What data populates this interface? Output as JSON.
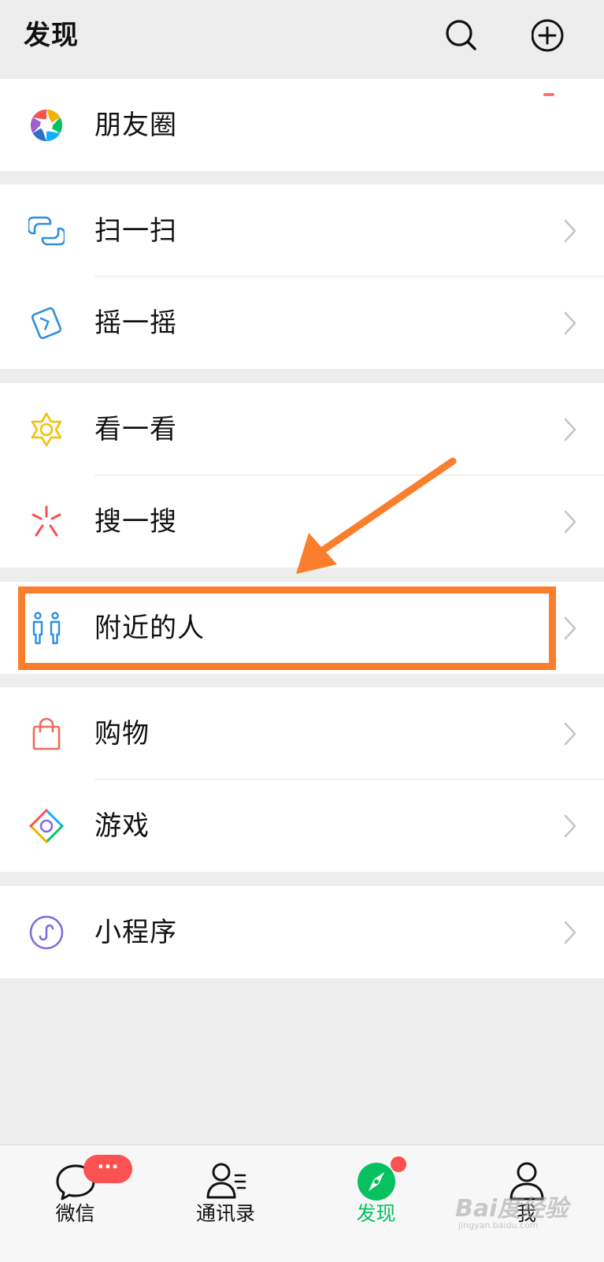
{
  "header": {
    "title": "发现",
    "search_icon": "search-icon",
    "add_icon": "plus-circle-icon"
  },
  "menu": {
    "moments": {
      "label": "朋友圈",
      "icon": "moments-aperture-icon"
    },
    "scan": {
      "label": "扫一扫",
      "icon": "scan-icon"
    },
    "shake": {
      "label": "摇一摇",
      "icon": "shake-icon"
    },
    "top_stories": {
      "label": "看一看",
      "icon": "top-stories-icon"
    },
    "search": {
      "label": "搜一搜",
      "icon": "search-sparkle-icon"
    },
    "nearby": {
      "label": "附近的人",
      "icon": "people-nearby-icon"
    },
    "shopping": {
      "label": "购物",
      "icon": "shopping-bag-icon"
    },
    "games": {
      "label": "游戏",
      "icon": "games-diamond-icon"
    },
    "mini_programs": {
      "label": "小程序",
      "icon": "mini-programs-icon"
    }
  },
  "tabbar": {
    "chats": {
      "label": "微信",
      "badge": "···"
    },
    "contacts": {
      "label": "通讯录"
    },
    "discover": {
      "label": "发现"
    },
    "me": {
      "label": "我"
    }
  },
  "watermark": {
    "logo": "Bai度经验",
    "sub": "jingyan.baidu.com"
  },
  "colors": {
    "accent_green": "#07c160",
    "badge_red": "#fa5151",
    "annotation_orange": "#fb7e2d",
    "background": "#ededed"
  }
}
